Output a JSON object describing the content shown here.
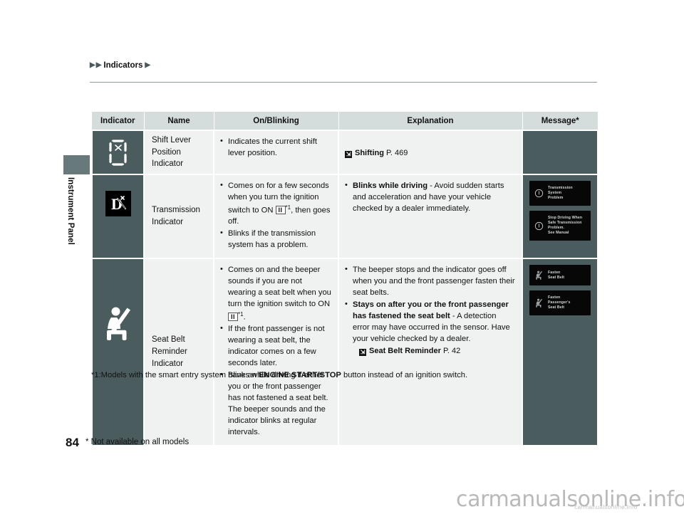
{
  "breadcrumb": {
    "label": "Indicators",
    "arrow": "▶"
  },
  "side_tab": {
    "label": "Instrument Panel"
  },
  "table": {
    "headers": [
      "Indicator",
      "Name",
      "On/Blinking",
      "Explanation",
      "Message*"
    ],
    "rows": [
      {
        "icon": "shift-lever-position-indicator-icon",
        "name": "Shift Lever\nPosition\nIndicator",
        "name_lines": [
          "Shift Lever",
          "Position",
          "Indicator"
        ],
        "on_blinking": [
          {
            "text": "Indicates the current shift lever position."
          }
        ],
        "explanation_ref": {
          "icon": "reference-arrow-icon",
          "title": "Shifting",
          "page": "P. 469"
        },
        "messages": []
      },
      {
        "icon": "transmission-indicator-icon",
        "name_lines": [
          "Transmission",
          "Indicator"
        ],
        "on_blinking": [
          {
            "pre": "Comes on for a few seconds when you turn the ignition switch to ON ",
            "key": "II",
            "fn": "*1",
            "post": ", then goes off."
          },
          {
            "text": "Blinks if the transmission system has a problem."
          }
        ],
        "explanation": [
          {
            "bold": "Blinks while driving",
            "rest": " - Avoid sudden starts and acceleration and have your vehicle checked by a dealer immediately."
          }
        ],
        "messages": [
          {
            "icon": "warning-circle-icon",
            "lines": [
              "Transmission",
              "System",
              "Problem"
            ]
          },
          {
            "icon": "warning-circle-icon",
            "lines": [
              "Stop Driving When",
              "Safe Transmission",
              "Problem.",
              "See Manual"
            ]
          }
        ]
      },
      {
        "icon": "seat-belt-reminder-icon",
        "name_lines": [
          "Seat Belt",
          "Reminder",
          "Indicator"
        ],
        "on_blinking": [
          {
            "pre": "Comes on and the beeper sounds if you are not wearing a seat belt when you turn the ignition switch to ON ",
            "key": "II",
            "fn": "*1",
            "post": "."
          },
          {
            "text": "If the front passenger is not wearing a seat belt, the indicator comes on a few seconds later."
          },
          {
            "text": "Blinks while driving if either you or the front passenger has not fastened a seat belt. The beeper sounds and the indicator blinks at regular intervals."
          }
        ],
        "explanation": [
          {
            "rest": "The beeper stops and the indicator goes off when you and the front passenger fasten their seat belts."
          },
          {
            "bold": "Stays on after you or the front passenger has fastened the seat belt",
            "rest": " - A detection error may have occurred in the sensor. Have your vehicle checked by a dealer."
          }
        ],
        "explanation_ref": {
          "icon": "reference-arrow-icon",
          "title": "Seat Belt Reminder",
          "page": "P. 42"
        },
        "messages": [
          {
            "icon": "seat-belt-small-icon",
            "lines": [
              "Fasten",
              "Seat Belt"
            ]
          },
          {
            "icon": "seat-belt-small-icon",
            "lines": [
              "Fasten",
              "Passenger's",
              "Seat Belt"
            ]
          }
        ]
      }
    ]
  },
  "footnote": {
    "pre": "*1:Models with the smart entry system have an ",
    "bold": "ENGINE START/STOP",
    "post": " button instead of an ignition switch."
  },
  "footer": {
    "page_number": "84",
    "note": "* Not available on all models"
  },
  "watermark": {
    "big": "carmanualsonline.info",
    "small": "carmanualsonline.info"
  },
  "colors": {
    "header_bg": "#d5dcdc",
    "icon_cell_bg": "#4b5c5e",
    "cell_bg": "#f0f1f1",
    "display_bg": "#070707",
    "tab": "#67797b"
  }
}
